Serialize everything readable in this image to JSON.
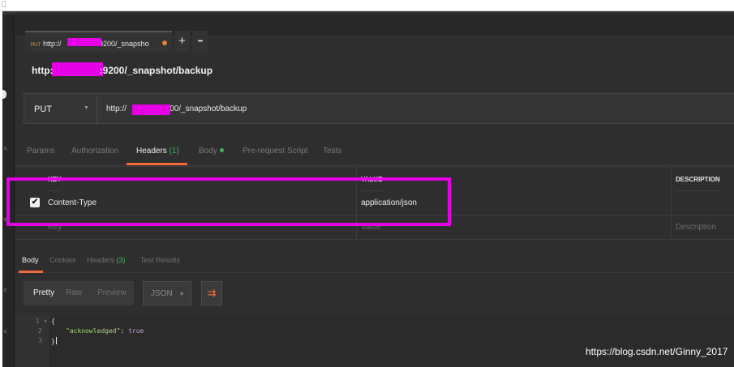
{
  "window": {
    "corner_mark": "⎕"
  },
  "sidebar": {
    "marks": [
      "c",
      "c",
      "c",
      "c"
    ]
  },
  "request_tab": {
    "method": "PUT",
    "label_prefix": "http://",
    "label_suffix": ":9200/_snapsho",
    "new_tab": "+",
    "more": "•••"
  },
  "request_title": {
    "prefix": "http:",
    "suffix": ":9200/_snapshot/backup"
  },
  "url_bar": {
    "method": "PUT",
    "method_caret": "▼",
    "url_prefix": "http://",
    "url_suffix": "9200/_snapshot/backup"
  },
  "request_tabs": [
    {
      "label": "Params"
    },
    {
      "label": "Authorization"
    },
    {
      "label": "Headers",
      "count": "(1)"
    },
    {
      "label": "Body"
    },
    {
      "label": "Pre-request Script"
    },
    {
      "label": "Tests"
    }
  ],
  "headers_table": {
    "columns": [
      "KEY",
      "VALUE",
      "DESCRIPTION"
    ],
    "rows": [
      {
        "checked": true,
        "check_glyph": "✔",
        "key": "Content-Type",
        "value": "application/json",
        "description": ""
      }
    ],
    "placeholders": {
      "key": "Key",
      "value": "Value",
      "description": "Description"
    }
  },
  "response_tabs": [
    {
      "label": "Body"
    },
    {
      "label": "Cookies"
    },
    {
      "label": "Headers",
      "count": "(3)"
    },
    {
      "label": "Test Results"
    }
  ],
  "view_modes": [
    "Pretty",
    "Raw",
    "Preview"
  ],
  "format_select": {
    "value": "JSON",
    "caret": "▼"
  },
  "wrap_icon": "⇉",
  "response_body": {
    "line_numbers": [
      "1 ▾",
      "2",
      "3"
    ],
    "open_brace": "{",
    "key": "\"acknowledged\"",
    "colon": ": ",
    "value": "true",
    "close_brace": "}"
  },
  "watermark": "https://blog.csdn.net/Ginny_2017",
  "colors": {
    "accent": "#f26b3a",
    "highlight": "#e500e5",
    "count_green": "#47b35c"
  }
}
